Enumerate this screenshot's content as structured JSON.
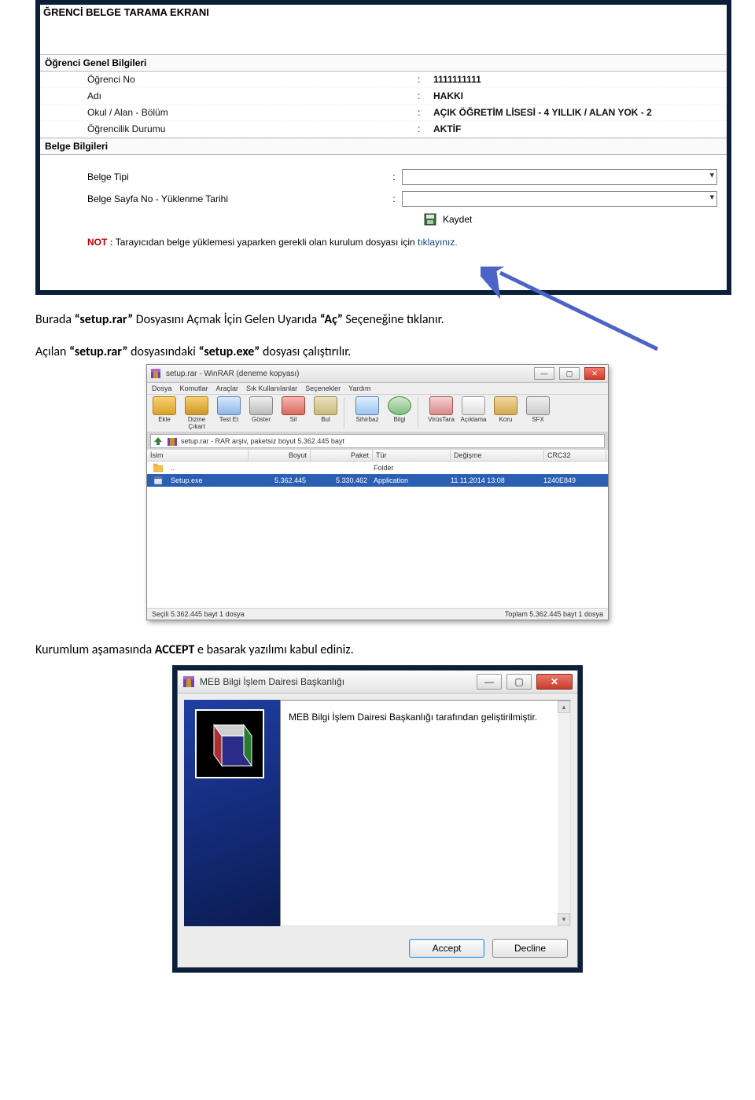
{
  "panel1": {
    "title": "ĞRENCİ BELGE TARAMA EKRANI",
    "section_student": "Öğrenci Genel Bilgileri",
    "rows": {
      "ogrno_label": "Öğrenci No",
      "ogrno_value": "1111111111",
      "adi_label": "Adı",
      "adi_value": "HAKKI",
      "okul_label": "Okul / Alan - Bölüm",
      "okul_value": "AÇIK ÖĞRETİM LİSESİ - 4 YILLIK / ALAN YOK - 2",
      "durum_label": "Öğrencilik Durumu",
      "durum_value": "AKTİF"
    },
    "section_doc": "Belge Bilgileri",
    "form": {
      "belge_tipi_label": "Belge Tipi",
      "yuklenme_label": "Belge Sayfa No - Yüklenme Tarihi",
      "save_label": "Kaydet",
      "note_prefix": "NOT :",
      "note_text": " Tarayıcıdan belge yüklemesi yaparken gerekli olan kurulum dosyası için ",
      "note_link": "tıklayınız."
    }
  },
  "text1_pre": "Burada ",
  "text1_b1": "“setup.rar”",
  "text1_mid": " Dosyasını Açmak İçin Gelen Uyarıda ",
  "text1_b2": "“Aç”",
  "text1_post": " Seçeneğine tıklanır.",
  "text2_pre": "Açılan ",
  "text2_b1": "“setup.rar”",
  "text2_mid": " dosyasındaki ",
  "text2_b2": "“setup.exe”",
  "text2_post": " dosyası çalıştırılır.",
  "winrar": {
    "title": "setup.rar - WinRAR (deneme kopyası)",
    "menu": [
      "Dosya",
      "Komutlar",
      "Araçlar",
      "Sık Kullanılanlar",
      "Seçenekler",
      "Yardım"
    ],
    "toolbar": [
      "Ekle",
      "Dizine Çıkart",
      "Test Et",
      "Göster",
      "Sil",
      "Bul",
      "Sihirbaz",
      "Bilgi",
      "VirüsTara",
      "Açıklama",
      "Koru",
      "SFX"
    ],
    "addr": "setup.rar - RAR arşiv, paketsiz boyut 5.362.445 bayt",
    "cols": {
      "name": "İsim",
      "size": "Boyut",
      "packed": "Paket",
      "type": "Tür",
      "date": "Değişme",
      "crc": "CRC32"
    },
    "row_up_type": "Folder",
    "row_sel": {
      "name": "Setup.exe",
      "size": "5.362.445",
      "packed": "5.330.462",
      "type": "Application",
      "date": "11.11.2014 13:08",
      "crc": "1240E849"
    },
    "status_left": "Seçili 5.362.445 bayt 1 dosya",
    "status_right": "Toplam 5.362.445 bayt 1 dosya"
  },
  "text3_pre": "Kurumlum aşamasında ",
  "text3_b1": "ACCEPT",
  "text3_post": " e basarak yazılımı kabul ediniz.",
  "installer": {
    "title": "MEB Bilgi İşlem Dairesi Başkanlığı",
    "message": "MEB Bilgi İşlem Dairesi Başkanlığı tarafından geliştirilmiştir.",
    "accept": "Accept",
    "decline": "Decline"
  }
}
